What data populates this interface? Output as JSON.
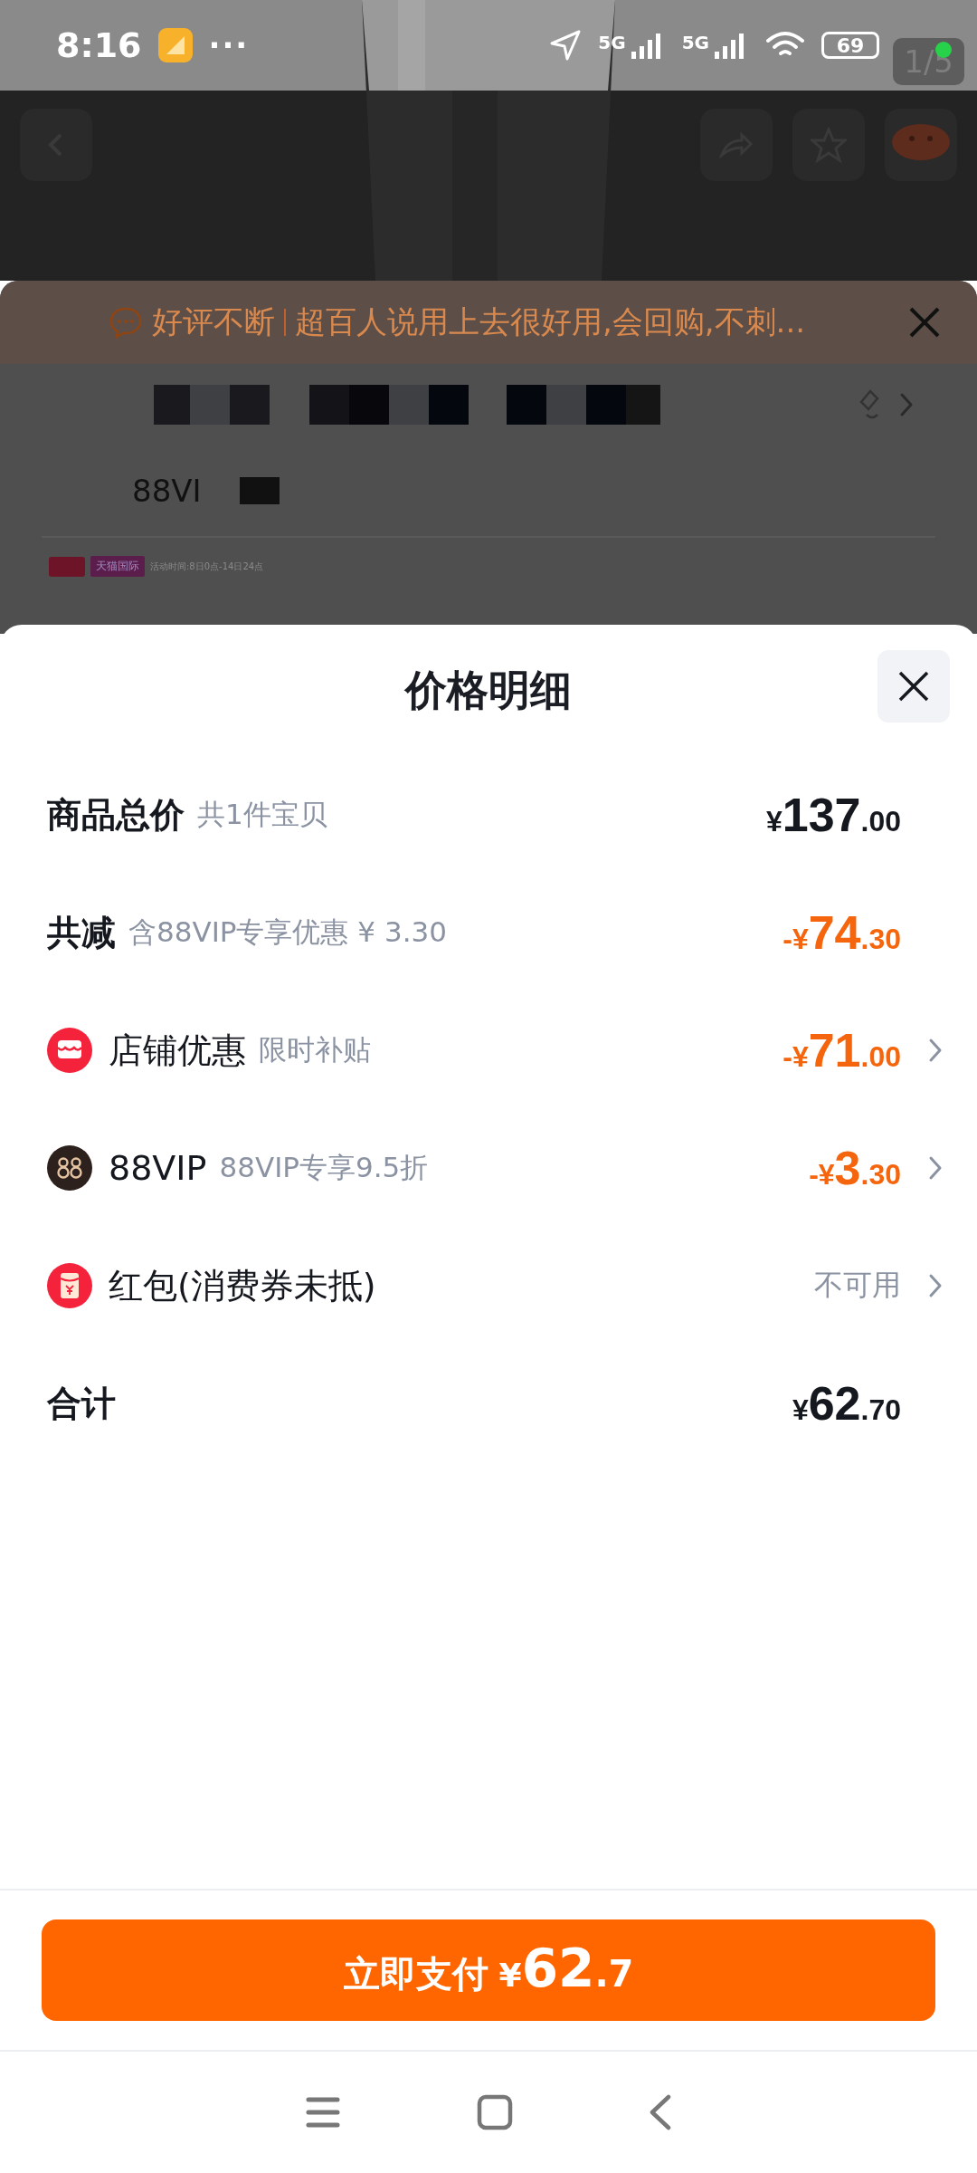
{
  "status_bar": {
    "time": "8:16",
    "more": "···",
    "network_1": "5G",
    "network_2": "5G",
    "battery": "69"
  },
  "gallery": {
    "counter": "1/5"
  },
  "review_banner": {
    "tag": "好评不断",
    "text": "超百人说用上去很好用,会回购,不刺..."
  },
  "product_summary": {
    "vip_text": "88VI",
    "tag_label": "天猫国际",
    "tag_note": "活动时间:8日0点-14日24点"
  },
  "sheet": {
    "title": "价格明细",
    "rows": [
      {
        "kind": "summary",
        "label": "商品总价",
        "note": "共1件宝贝",
        "amount": {
          "discount": false,
          "currency": "¥",
          "integer": "137",
          "fraction": ".00"
        },
        "chevron": false
      },
      {
        "kind": "summary",
        "label": "共减",
        "note": "含88VIP专享优惠 ¥ 3.30",
        "amount": {
          "discount": true,
          "currency": "-¥",
          "integer": "74",
          "fraction": ".30"
        },
        "chevron": false
      },
      {
        "kind": "shop",
        "label": "店铺优惠",
        "note": "限时补贴",
        "amount": {
          "discount": true,
          "currency": "-¥",
          "integer": "71",
          "fraction": ".00"
        },
        "chevron": true
      },
      {
        "kind": "vip",
        "label": "88VIP",
        "note": "88VIP专享9.5折",
        "amount": {
          "discount": true,
          "currency": "-¥",
          "integer": "3",
          "fraction": ".30"
        },
        "chevron": true
      },
      {
        "kind": "coupon",
        "label": "红包(消费券未抵)",
        "status": "不可用",
        "chevron": true
      },
      {
        "kind": "summary",
        "label": "合计",
        "amount": {
          "discount": false,
          "currency": "¥",
          "integer": "62",
          "fraction": ".70"
        },
        "chevron": false
      }
    ],
    "pay_button": {
      "label": "立即支付",
      "currency": "¥",
      "integer": "62",
      "fraction": ".7"
    }
  }
}
